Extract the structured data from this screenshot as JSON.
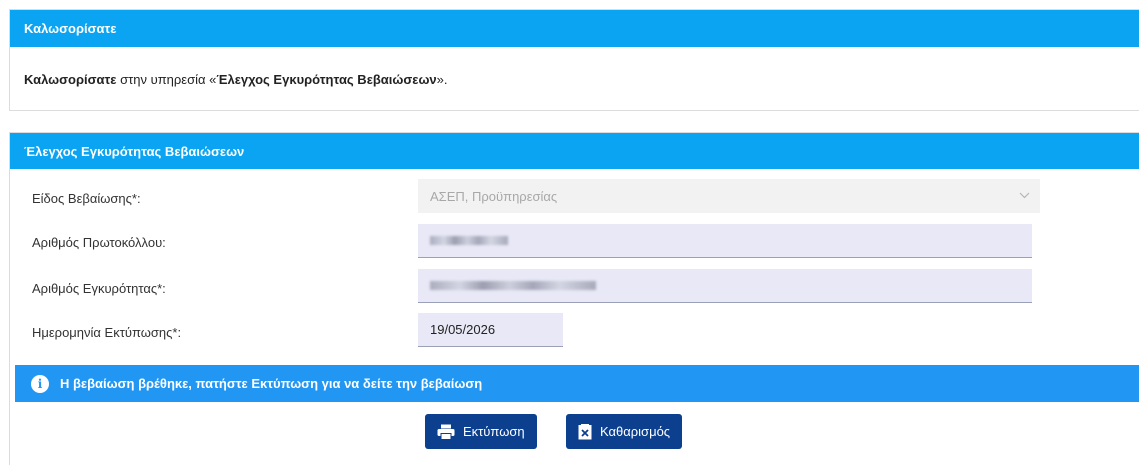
{
  "welcome": {
    "header": "Καλωσορίσατε",
    "text_bold": "Καλωσορίσατε",
    "text_middle": " στην υπηρεσία «",
    "service_name": "Έλεγχος Εγκυρότητας Βεβαιώσεων",
    "text_end": "»."
  },
  "form": {
    "header": "Έλεγχος Εγκυρότητας Βεβαιώσεων",
    "type_label": "Είδος Βεβαίωσης*:",
    "type_value": "ΑΣΕΠ, Προϋπηρεσίας",
    "protocol_label": "Αριθμός Πρωτοκόλλου:",
    "validity_label": "Αριθμός Εγκυρότητας*:",
    "print_date_label": "Ημερομηνία Εκτύπωσης*:",
    "print_date_value": "19/05/2026"
  },
  "alert": {
    "icon": "info-icon",
    "text": "Η βεβαίωση βρέθηκε, πατήστε Εκτύπωση για να δείτε την βεβαίωση"
  },
  "buttons": {
    "print_label": "Εκτύπωση",
    "print_icon": "printer-icon",
    "clear_label": "Καθαρισμός",
    "clear_icon": "clear-icon"
  },
  "colors": {
    "header_blue": "#0aa4f2",
    "alert_blue": "#2196f3",
    "button_navy": "#0d3f8f"
  }
}
